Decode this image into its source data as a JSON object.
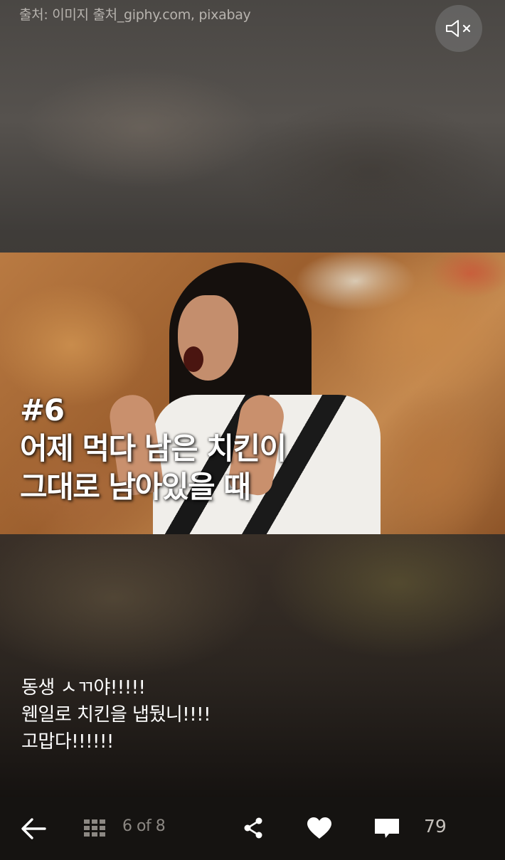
{
  "header": {
    "source_credit": "출처: 이미지 출처_giphy.com, pixabay",
    "mute_icon": "speaker-muted-icon"
  },
  "slide": {
    "caption_lines": [
      "#6",
      "어제 먹다 남은 치킨이",
      "그대로 남아있을 때"
    ],
    "description_lines": [
      "동생 ㅅㄲ야!!!!!",
      "웬일로 치킨을 냅뒀니!!!!",
      "고맙다!!!!!!"
    ]
  },
  "toolbar": {
    "back_icon": "arrow-left-icon",
    "grid_icon": "grid-icon",
    "page_indicator": "6 of 8",
    "share_icon": "share-icon",
    "like_icon": "heart-icon",
    "comment_icon": "comment-icon",
    "comment_count": "79"
  },
  "colors": {
    "toolbar_bg": "#151311",
    "icon_light": "#ffffff",
    "icon_gray": "#8c8883"
  }
}
